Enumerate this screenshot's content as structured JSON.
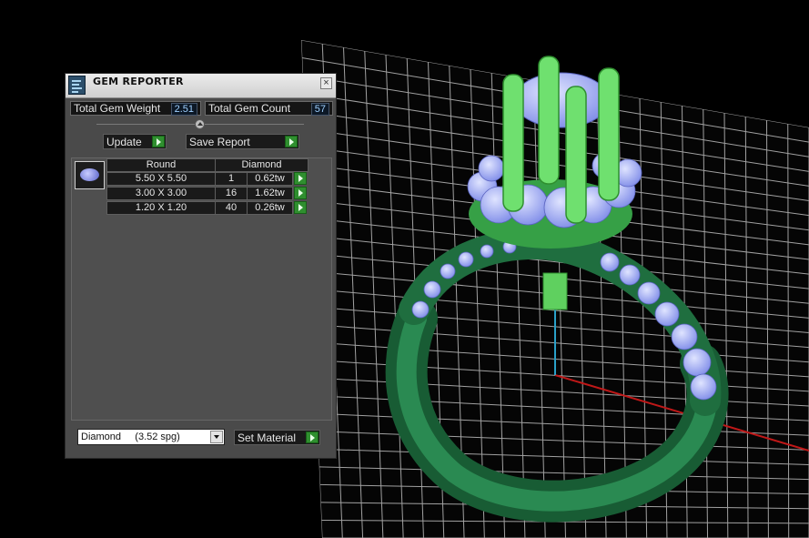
{
  "panel": {
    "title": "GEM REPORTER",
    "close_icon": "close-icon",
    "total_gem_weight": {
      "label": "Total Gem Weight",
      "value": "2.51"
    },
    "total_gem_count": {
      "label": "Total Gem Count",
      "value": "57"
    },
    "update_label": "Update",
    "save_report_label": "Save Report",
    "gem_group": {
      "shape": "Round",
      "material": "Diamond",
      "rows": [
        {
          "size": "5.50 X 5.50",
          "count": "1",
          "weight": "0.62tw"
        },
        {
          "size": "3.00 X 3.00",
          "count": "16",
          "weight": "1.62tw"
        },
        {
          "size": "1.20 X 1.20",
          "count": "40",
          "weight": "0.26tw"
        }
      ]
    },
    "material_select": "Diamond     (3.52 spg)",
    "set_material_label": "Set Material"
  },
  "colors": {
    "panel_bg": "#4a4a4a",
    "accent_green": "#2f8f2f",
    "metal": "#1f6e3f",
    "highlight_metal": "#6fe06f",
    "gem": "#a8b4ff"
  }
}
